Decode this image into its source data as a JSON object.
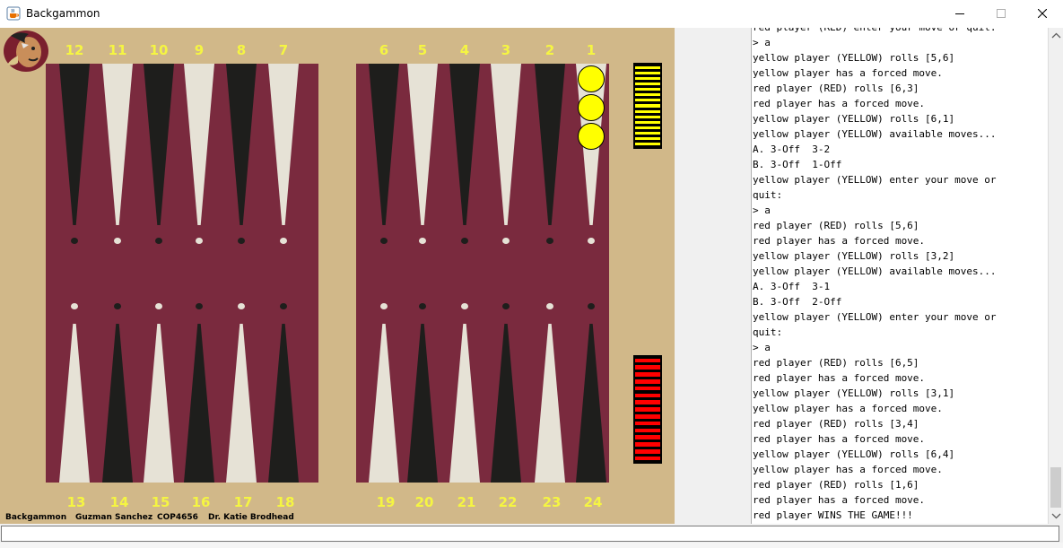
{
  "window": {
    "title": "Backgammon",
    "icon": "java-cup-icon",
    "controls": [
      "minimize-icon",
      "maximize-icon",
      "close-icon"
    ]
  },
  "board": {
    "colors": {
      "background": "#d1b889",
      "felt": "#7a2a3e",
      "light_point": "#e6e2d6",
      "dark_point": "#1e1e1c",
      "number": "#f5f542",
      "yellow_checker": "#ffff00",
      "red_checker": "#ff0000"
    },
    "top_numbers": [
      "12",
      "11",
      "10",
      "9",
      "8",
      "7",
      "6",
      "5",
      "4",
      "3",
      "2",
      "1"
    ],
    "bottom_numbers": [
      "13",
      "14",
      "15",
      "16",
      "17",
      "18",
      "19",
      "20",
      "21",
      "22",
      "23",
      "24"
    ],
    "checkers": [
      {
        "point": "1",
        "color": "yellow",
        "count": 3
      }
    ],
    "bear_off": {
      "yellow": {
        "stripes": 15
      },
      "red": {
        "stripes": 15
      }
    },
    "footer": {
      "game": "Backgammon",
      "author": "Guzman Sanchez",
      "course": "COP4656",
      "instructor": "Dr. Katie Brodhead"
    }
  },
  "log": {
    "lines": [
      "red player (RED) enter your move or quit:",
      "> a",
      "yellow player (YELLOW) rolls [5,6]",
      "yellow player has a forced move.",
      "red player (RED) rolls [6,3]",
      "red player has a forced move.",
      "yellow player (YELLOW) rolls [6,1]",
      "yellow player (YELLOW) available moves...",
      "A. 3-Off  3-2",
      "B. 3-Off  1-Off",
      "yellow player (YELLOW) enter your move or",
      "quit:",
      "> a",
      "red player (RED) rolls [5,6]",
      "red player has a forced move.",
      "yellow player (YELLOW) rolls [3,2]",
      "yellow player (YELLOW) available moves...",
      "A. 3-Off  3-1",
      "B. 3-Off  2-Off",
      "yellow player (YELLOW) enter your move or",
      "quit:",
      "> a",
      "red player (RED) rolls [6,5]",
      "red player has a forced move.",
      "yellow player (YELLOW) rolls [3,1]",
      "yellow player has a forced move.",
      "red player (RED) rolls [3,4]",
      "red player has a forced move.",
      "yellow player (YELLOW) rolls [6,4]",
      "yellow player has a forced move.",
      "red player (RED) rolls [1,6]",
      "red player has a forced move.",
      "red player WINS THE GAME!!!"
    ]
  },
  "input": {
    "value": ""
  }
}
